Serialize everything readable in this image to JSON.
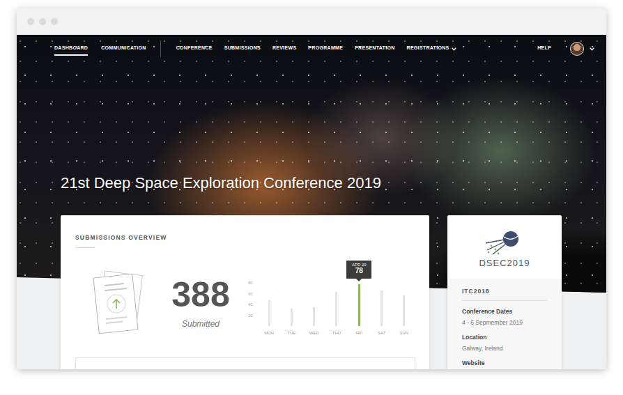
{
  "nav": {
    "primary": [
      {
        "label": "DASHBOARD",
        "selected": true,
        "kind": "link"
      },
      {
        "label": "COMMUNICATION",
        "selected": false,
        "kind": "link"
      }
    ],
    "conference": [
      {
        "label": "CONFERENCE",
        "selected": false,
        "kind": "link"
      },
      {
        "label": "SUBMISSIONS",
        "selected": false,
        "kind": "link"
      },
      {
        "label": "REVIEWS",
        "selected": false,
        "kind": "link"
      },
      {
        "label": "PROGRAMME",
        "selected": false,
        "kind": "link"
      },
      {
        "label": "PRESENTATION",
        "selected": false,
        "kind": "link"
      },
      {
        "label": "REGISTRATIONS",
        "selected": false,
        "kind": "dropdown"
      }
    ],
    "help": "HELP"
  },
  "page_title": "21st Deep Space Exploration Conference 2019",
  "submissions_overview": {
    "title": "SUBMISSIONS OVERVIEW",
    "count": "388",
    "count_label": "Submitted",
    "chart": {
      "ticks": [
        "80",
        "60",
        "40",
        "20"
      ],
      "bars": [
        {
          "label": "MON",
          "value": 48,
          "selected": false
        },
        {
          "label": "TUE",
          "value": 33,
          "selected": false
        },
        {
          "label": "WED",
          "value": 35,
          "selected": false
        },
        {
          "label": "THU",
          "value": 64,
          "selected": false
        },
        {
          "label": "FRI",
          "value": 78,
          "selected": true
        },
        {
          "label": "SAT",
          "value": 66,
          "selected": false
        },
        {
          "label": "SUN",
          "value": 57,
          "selected": false
        }
      ],
      "tooltip": {
        "date": "APR 20",
        "value": "78"
      }
    }
  },
  "conference_card": {
    "logo_text": "DSEC2019",
    "code": "ITC2018",
    "fields": [
      {
        "label": "Conference Dates",
        "value": "4 - 6 Sepmember 2019"
      },
      {
        "label": "Location",
        "value": "Galway, Ireland"
      },
      {
        "label": "Website"
      }
    ]
  }
}
